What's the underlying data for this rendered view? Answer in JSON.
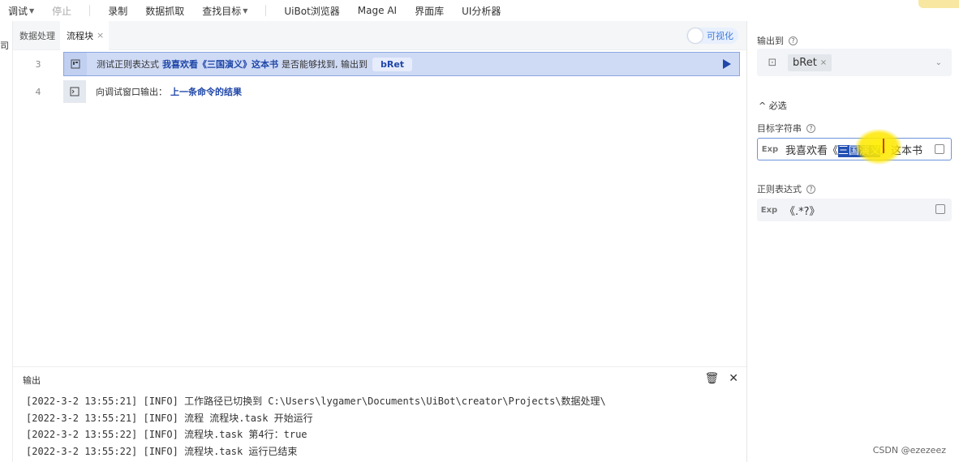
{
  "toolbar": {
    "debug": "调试",
    "stop": "停止",
    "record": "录制",
    "data_capture": "数据抓取",
    "find_target": "查找目标",
    "browser": "UiBot浏览器",
    "mage_ai": "Mage AI",
    "ui_library": "界面库",
    "ui_analyzer": "UI分析器"
  },
  "left_strip": {
    "glyph": "司"
  },
  "tabs": [
    {
      "label": "数据处理"
    },
    {
      "label": "流程块"
    }
  ],
  "visual_toggle": {
    "label": "可视化"
  },
  "rows": [
    {
      "line": "3",
      "prefix": "测试正则表达式",
      "target": "我喜欢看《三国演义》这本书",
      "middle": "是否能够找到, 输出到",
      "var": "bRet"
    },
    {
      "line": "4",
      "prefix": "向调试窗口输出：",
      "target": "上一条命令的结果"
    }
  ],
  "output": {
    "title": "输出",
    "lines": [
      "[2022-3-2 13:55:21] [INFO] 工作路径已切换到 C:\\Users\\lygamer\\Documents\\UiBot\\creator\\Projects\\数据处理\\",
      "[2022-3-2 13:55:21] [INFO] 流程 流程块.task 开始运行",
      "[2022-3-2 13:55:22] [INFO] 流程块.task 第4行：true",
      "[2022-3-2 13:55:22] [INFO] 流程块.task 运行已结束"
    ]
  },
  "properties": {
    "output_to_label": "输出到",
    "output_var": "bRet",
    "required_section": "^ 必选",
    "target_string_label": "目标字符串",
    "target_string_parts": {
      "before": "我喜欢看《",
      "selected": "三国演义",
      "after": "》这本书"
    },
    "regex_label": "正则表达式",
    "regex_value": "《.*?》",
    "exp_tag": "Exp"
  },
  "watermark": "CSDN @ezezeez"
}
